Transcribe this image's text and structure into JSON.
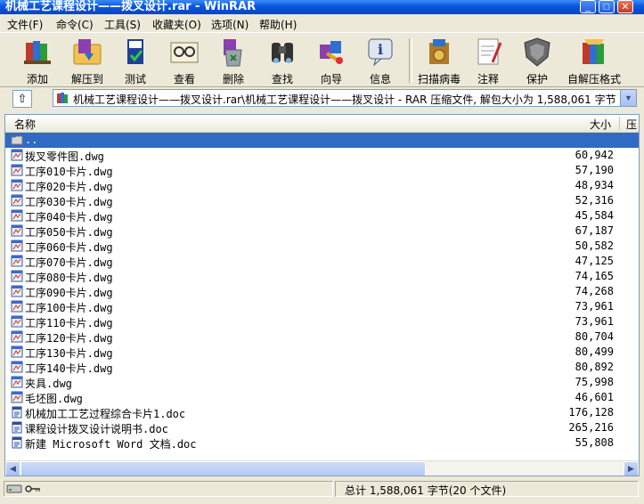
{
  "window": {
    "title": "机械工艺课程设计——拨叉设计.rar - WinRAR"
  },
  "menu": [
    "文件(F)",
    "命令(C)",
    "工具(S)",
    "收藏夹(O)",
    "选项(N)",
    "帮助(H)"
  ],
  "toolbar": [
    {
      "label": "添加",
      "icon": "add-books-icon"
    },
    {
      "label": "解压到",
      "icon": "extract-folder-icon"
    },
    {
      "label": "测试",
      "icon": "test-book-icon"
    },
    {
      "label": "查看",
      "icon": "view-glasses-icon"
    },
    {
      "label": "删除",
      "icon": "delete-recycle-icon"
    },
    {
      "label": "查找",
      "icon": "find-binoculars-icon"
    },
    {
      "label": "向导",
      "icon": "wizard-icon"
    },
    {
      "label": "信息",
      "icon": "info-icon"
    },
    {
      "label": "扫描病毒",
      "icon": "virus-scan-icon"
    },
    {
      "label": "注释",
      "icon": "comment-icon"
    },
    {
      "label": "保护",
      "icon": "protect-shield-icon"
    },
    {
      "label": "自解压格式",
      "icon": "sfx-icon"
    }
  ],
  "address": {
    "path": "机械工艺课程设计——拨叉设计.rar\\机械工艺课程设计——拨叉设计 - RAR 压缩文件, 解包大小为 1,588,061 字节"
  },
  "columns": {
    "name": "名称",
    "size": "大小",
    "packed": "压"
  },
  "files": [
    {
      "name": "..",
      "size": "",
      "type": "folder"
    },
    {
      "name": "拨叉零件图.dwg",
      "size": "60,942",
      "type": "dwg"
    },
    {
      "name": "工序010卡片.dwg",
      "size": "57,190",
      "type": "dwg"
    },
    {
      "name": "工序020卡片.dwg",
      "size": "48,934",
      "type": "dwg"
    },
    {
      "name": "工序030卡片.dwg",
      "size": "52,316",
      "type": "dwg"
    },
    {
      "name": "工序040卡片.dwg",
      "size": "45,584",
      "type": "dwg"
    },
    {
      "name": "工序050卡片.dwg",
      "size": "67,187",
      "type": "dwg"
    },
    {
      "name": "工序060卡片.dwg",
      "size": "50,582",
      "type": "dwg"
    },
    {
      "name": "工序070卡片.dwg",
      "size": "47,125",
      "type": "dwg"
    },
    {
      "name": "工序080卡片.dwg",
      "size": "74,165",
      "type": "dwg"
    },
    {
      "name": "工序090卡片.dwg",
      "size": "74,268",
      "type": "dwg"
    },
    {
      "name": "工序100卡片.dwg",
      "size": "73,961",
      "type": "dwg"
    },
    {
      "name": "工序110卡片.dwg",
      "size": "73,961",
      "type": "dwg"
    },
    {
      "name": "工序120卡片.dwg",
      "size": "80,704",
      "type": "dwg"
    },
    {
      "name": "工序130卡片.dwg",
      "size": "80,499",
      "type": "dwg"
    },
    {
      "name": "工序140卡片.dwg",
      "size": "80,892",
      "type": "dwg"
    },
    {
      "name": "夹具.dwg",
      "size": "75,998",
      "type": "dwg"
    },
    {
      "name": "毛坯图.dwg",
      "size": "46,601",
      "type": "dwg"
    },
    {
      "name": "机械加工工艺过程综合卡片1.doc",
      "size": "176,128",
      "type": "doc"
    },
    {
      "name": "课程设计拨叉设计说明书.doc",
      "size": "265,216",
      "type": "doc"
    },
    {
      "name": "新建 Microsoft Word 文档.doc",
      "size": "55,808",
      "type": "doc"
    }
  ],
  "status": {
    "summary": "总计 1,588,061 字节(20 个文件)"
  },
  "colors": {
    "title_bar": "#0a54e0",
    "selection": "#316ac5",
    "chrome": "#ece9d8"
  }
}
